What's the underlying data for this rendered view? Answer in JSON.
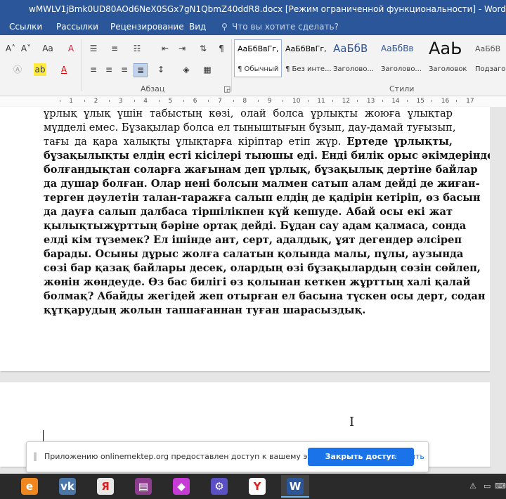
{
  "window": {
    "title": "wMWLV1jBmk0UD80AOd6NeX0SGx7gN1QbmZ40ddR8.docx [Режим ограниченной функциональности] - Word"
  },
  "menu": {
    "items": [
      "Ссылки",
      "Рассылки",
      "Рецензирование",
      "Вид"
    ],
    "search_placeholder": "Что вы хотите сделать?"
  },
  "ribbon": {
    "font_grow": "A˄",
    "font_shrink": "A˅",
    "change_case": "Aa",
    "clear_format": "A",
    "highlight": "ab",
    "font_color": "A",
    "paragraph_label": "Абзац",
    "styles_label": "Стили",
    "styles": [
      {
        "preview": "АаБбВвГг,",
        "name": "¶ Обычный"
      },
      {
        "preview": "АаБбВвГг,",
        "name": "¶ Без инте..."
      },
      {
        "preview": "АаБбВ",
        "name": "Заголово..."
      },
      {
        "preview": "АаБбВв",
        "name": "Заголово..."
      },
      {
        "preview": "АаЬ",
        "name": "Заголовок"
      },
      {
        "preview": "АаБбВ",
        "name": "Подзаго"
      }
    ],
    "show_marks": "¶"
  },
  "ruler": {
    "numbers": [
      "1",
      "2",
      "3",
      "4",
      "5",
      "6",
      "7",
      "8",
      "9",
      "10",
      "11",
      "12",
      "13",
      "14",
      "15",
      "16",
      "17"
    ]
  },
  "document": {
    "lines": [
      [
        {
          "t": "ұрлық ұлық үшін табыстың көзі, олай болса ұрлықты жоюға ұлықтар",
          "b": false
        }
      ],
      [
        {
          "t": "мүдделі емес. Бұзақылар болса ел тыныштығын бұзып, дау-дамай туғызып,",
          "b": false
        }
      ],
      [
        {
          "t": "тағы да қара халықты ұлықтарға кіріптар етіп жүр. ",
          "b": false
        },
        {
          "t": "Ертеде ұрлықты,",
          "b": true
        }
      ],
      [
        {
          "t": "бұзақылықты елдің есті кісілері тыюшы еді. Енді билік орыс әкімдерінде",
          "b": true
        }
      ],
      [
        {
          "t": "болғандықтан соларға жағынам деп ұрлық, бұзақылық дертіне байлар",
          "b": true
        }
      ],
      [
        {
          "t": "да душар болған. Олар нені болсын малмен сатып алам дейді де жиған-",
          "b": true
        }
      ],
      [
        {
          "t": "терген дәулетін талан-таражға салып елдің де қадірін кетіріп, өз басын",
          "b": true
        }
      ],
      [
        {
          "t": "да дауға салып далбаса тіршілікпен күй кешуде. Абай осы екі жат",
          "b": true
        }
      ],
      [
        {
          "t": "қылықтыжұрттың бәріне ортақ дейді. Бұдан сау адам қалмаса, сонда",
          "b": true
        }
      ],
      [
        {
          "t": "елді кім түземек? Ел ішінде ант, серт, адалдық, ұят дегендер әлсіреп",
          "b": true
        }
      ],
      [
        {
          "t": "барады. Осыны дұрыс жолға салатын қолында малы, пұлы, аузында",
          "b": true
        }
      ],
      [
        {
          "t": "сөзі бар қазақ байлары десек, олардың өзі бұзақылардың сөзін сөйлеп,",
          "b": true
        }
      ],
      [
        {
          "t": "жөнін жөндеуде. Өз бас билігі өз қолынан кеткен жұрттың халі қалай",
          "b": true
        }
      ],
      [
        {
          "t": "болмақ? Абайды жегідей жеп отырған ел басына түскен осы дерт, содан",
          "b": true
        }
      ],
      [
        {
          "t": "құтқарудың жолын таппағаннан туған шарасыздық.",
          "b": true
        }
      ]
    ]
  },
  "share_bar": {
    "message": "Приложению onlinemektep.org предоставлен доступ к вашему экрану.",
    "stop_label": "Закрыть доступ",
    "hide_label": "Скрыть"
  },
  "taskbar": {
    "apps": [
      {
        "name": "ie-icon",
        "glyph": "e",
        "color": "#f0861e"
      },
      {
        "name": "vk-icon",
        "glyph": "vk",
        "color": "#4a76a8"
      },
      {
        "name": "yandex-browser-icon",
        "glyph": "Я",
        "color": "#e8e8e8"
      },
      {
        "name": "winrar-icon",
        "glyph": "▤",
        "color": "#8e3d8e"
      },
      {
        "name": "gem-app-icon",
        "glyph": "◆",
        "color": "#c63ad6"
      },
      {
        "name": "settings-app-icon",
        "glyph": "⚙",
        "color": "#5b4fc4"
      },
      {
        "name": "yandex-icon",
        "glyph": "Y",
        "color": "#ffffff"
      },
      {
        "name": "word-icon",
        "glyph": "W",
        "color": "#2b579a"
      }
    ]
  }
}
